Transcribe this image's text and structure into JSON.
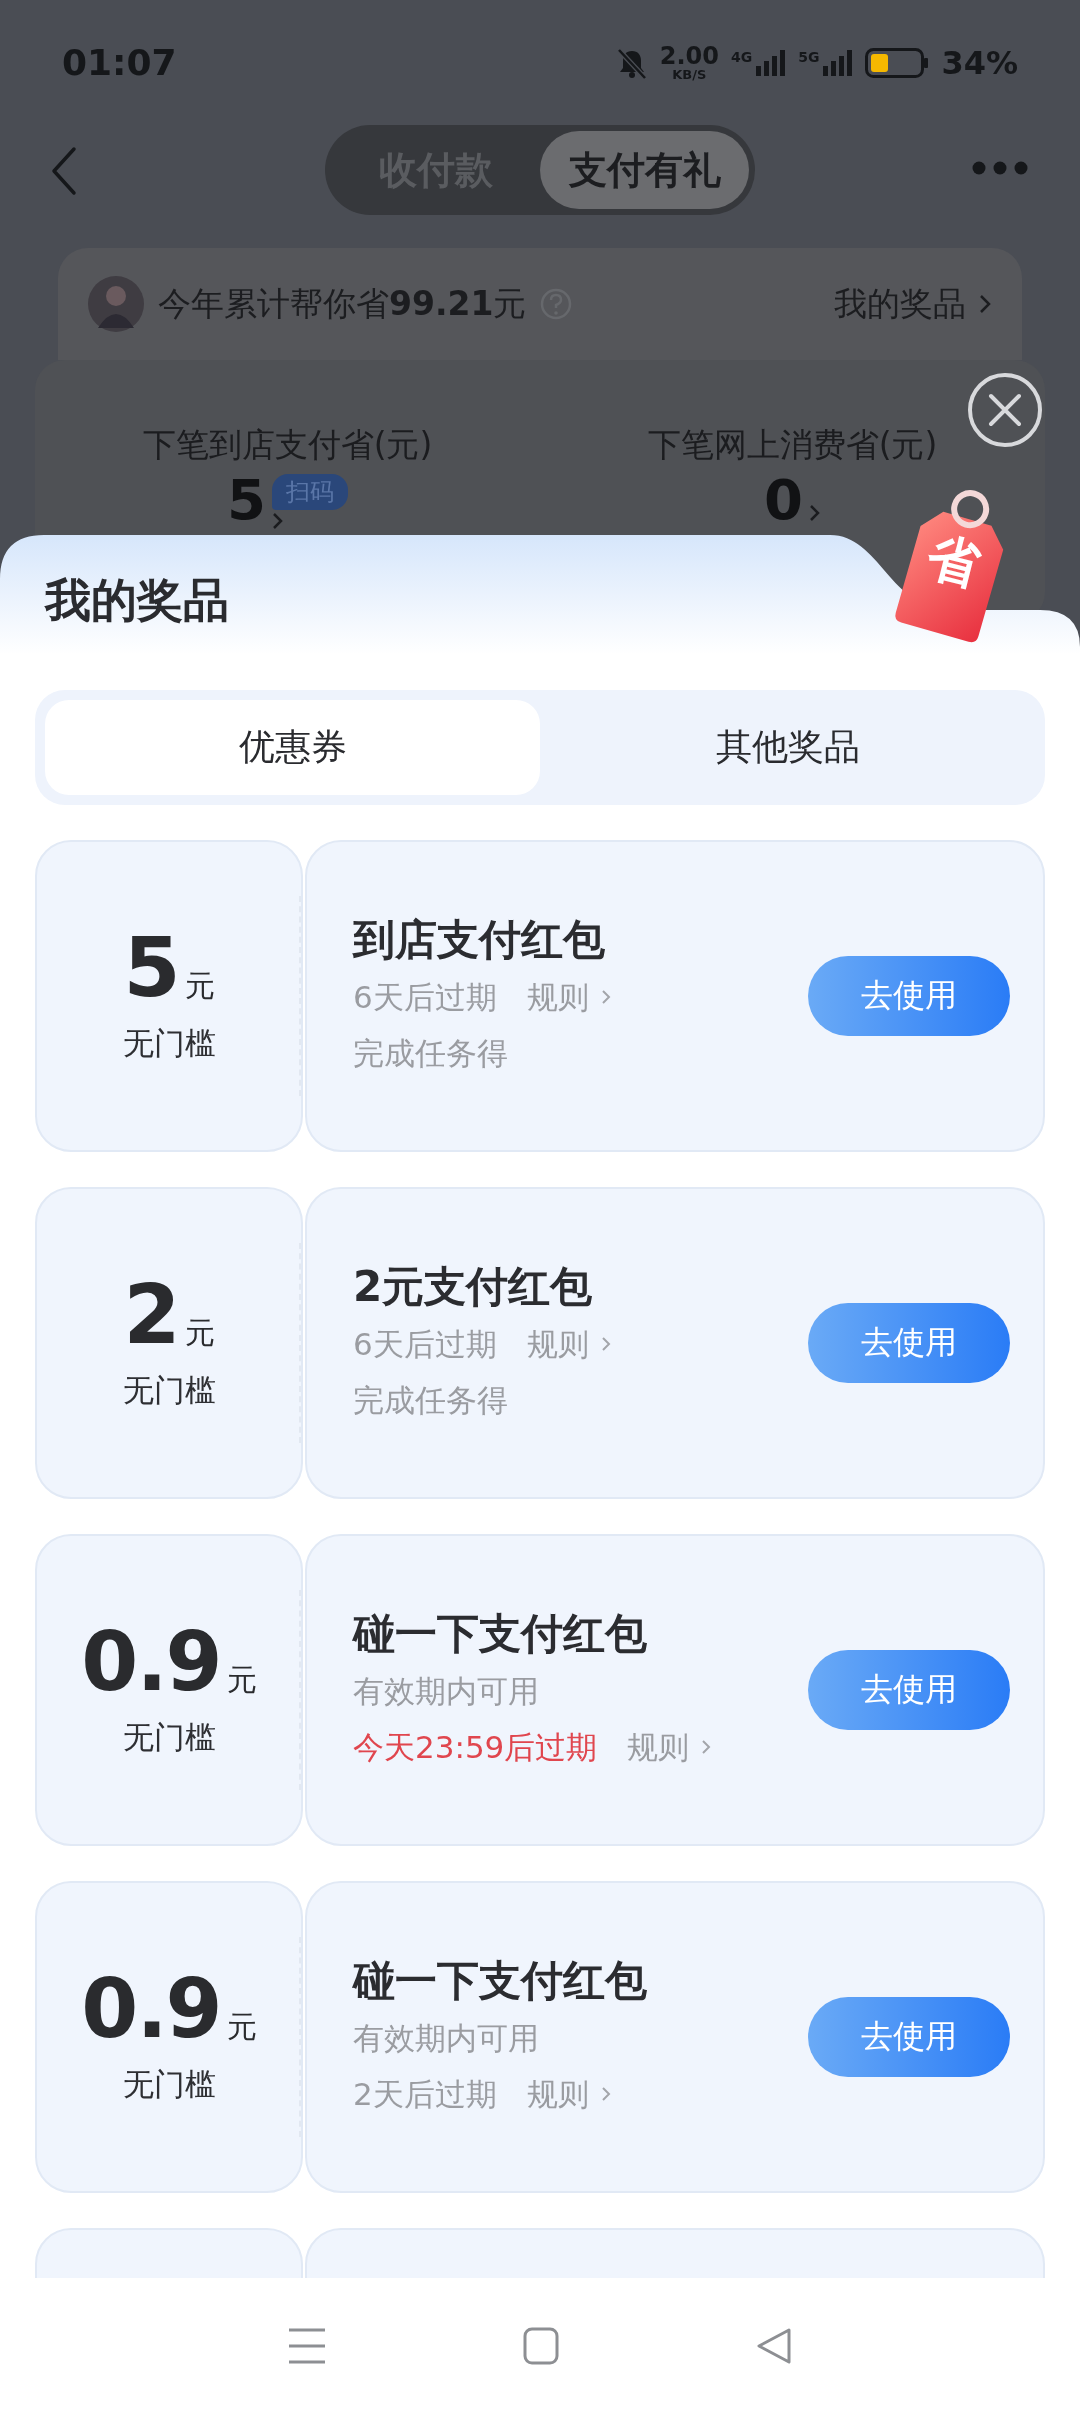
{
  "status_bar": {
    "time": "01:07",
    "net_speed": "2.00",
    "net_unit": "KB/S",
    "networks": [
      "4G",
      "5G"
    ],
    "battery": "34%"
  },
  "header": {
    "tabs": [
      {
        "label": "收付款",
        "selected": false
      },
      {
        "label": "支付有礼",
        "selected": true
      }
    ]
  },
  "summary": {
    "text": "今年累计帮你省**99.21**元",
    "link": "我的奖品"
  },
  "savings": [
    {
      "label": "下笔到店支付省(元)",
      "value": "5",
      "badge": "扫码"
    },
    {
      "label": "下笔网上消费省(元)",
      "value": "0"
    }
  ],
  "sheet": {
    "title": "我的奖品",
    "tag": "省",
    "tabs": [
      {
        "label": "优惠券",
        "selected": true
      },
      {
        "label": "其他奖品",
        "selected": false
      }
    ],
    "coupons": [
      {
        "kind": "full",
        "amount": "5",
        "unit": "元",
        "threshold": "无门槛",
        "title": "到店支付红包",
        "rows": [
          {
            "kind": "expiry",
            "text": "6天后过期",
            "urgent": false,
            "link": "规则"
          },
          {
            "kind": "note",
            "text": "完成任务得"
          }
        ],
        "button": "去使用"
      },
      {
        "kind": "full",
        "amount": "2",
        "unit": "元",
        "threshold": "无门槛",
        "title": "2元支付红包",
        "rows": [
          {
            "kind": "expiry",
            "text": "6天后过期",
            "urgent": false,
            "link": "规则"
          },
          {
            "kind": "note",
            "text": "完成任务得"
          }
        ],
        "button": "去使用"
      },
      {
        "kind": "full",
        "amount": "0.9",
        "unit": "元",
        "threshold": "无门槛",
        "title": "碰一下支付红包",
        "rows": [
          {
            "kind": "note",
            "text": "有效期内可用"
          },
          {
            "kind": "expiry",
            "text": "今天23:59后过期",
            "urgent": true,
            "link": "规则"
          }
        ],
        "button": "去使用"
      },
      {
        "kind": "full",
        "amount": "0.9",
        "unit": "元",
        "threshold": "无门槛",
        "title": "碰一下支付红包",
        "rows": [
          {
            "kind": "note",
            "text": "有效期内可用"
          },
          {
            "kind": "expiry",
            "text": "2天后过期",
            "urgent": false,
            "link": "规则"
          }
        ],
        "button": "去使用"
      },
      {
        "kind": "partial"
      }
    ]
  }
}
